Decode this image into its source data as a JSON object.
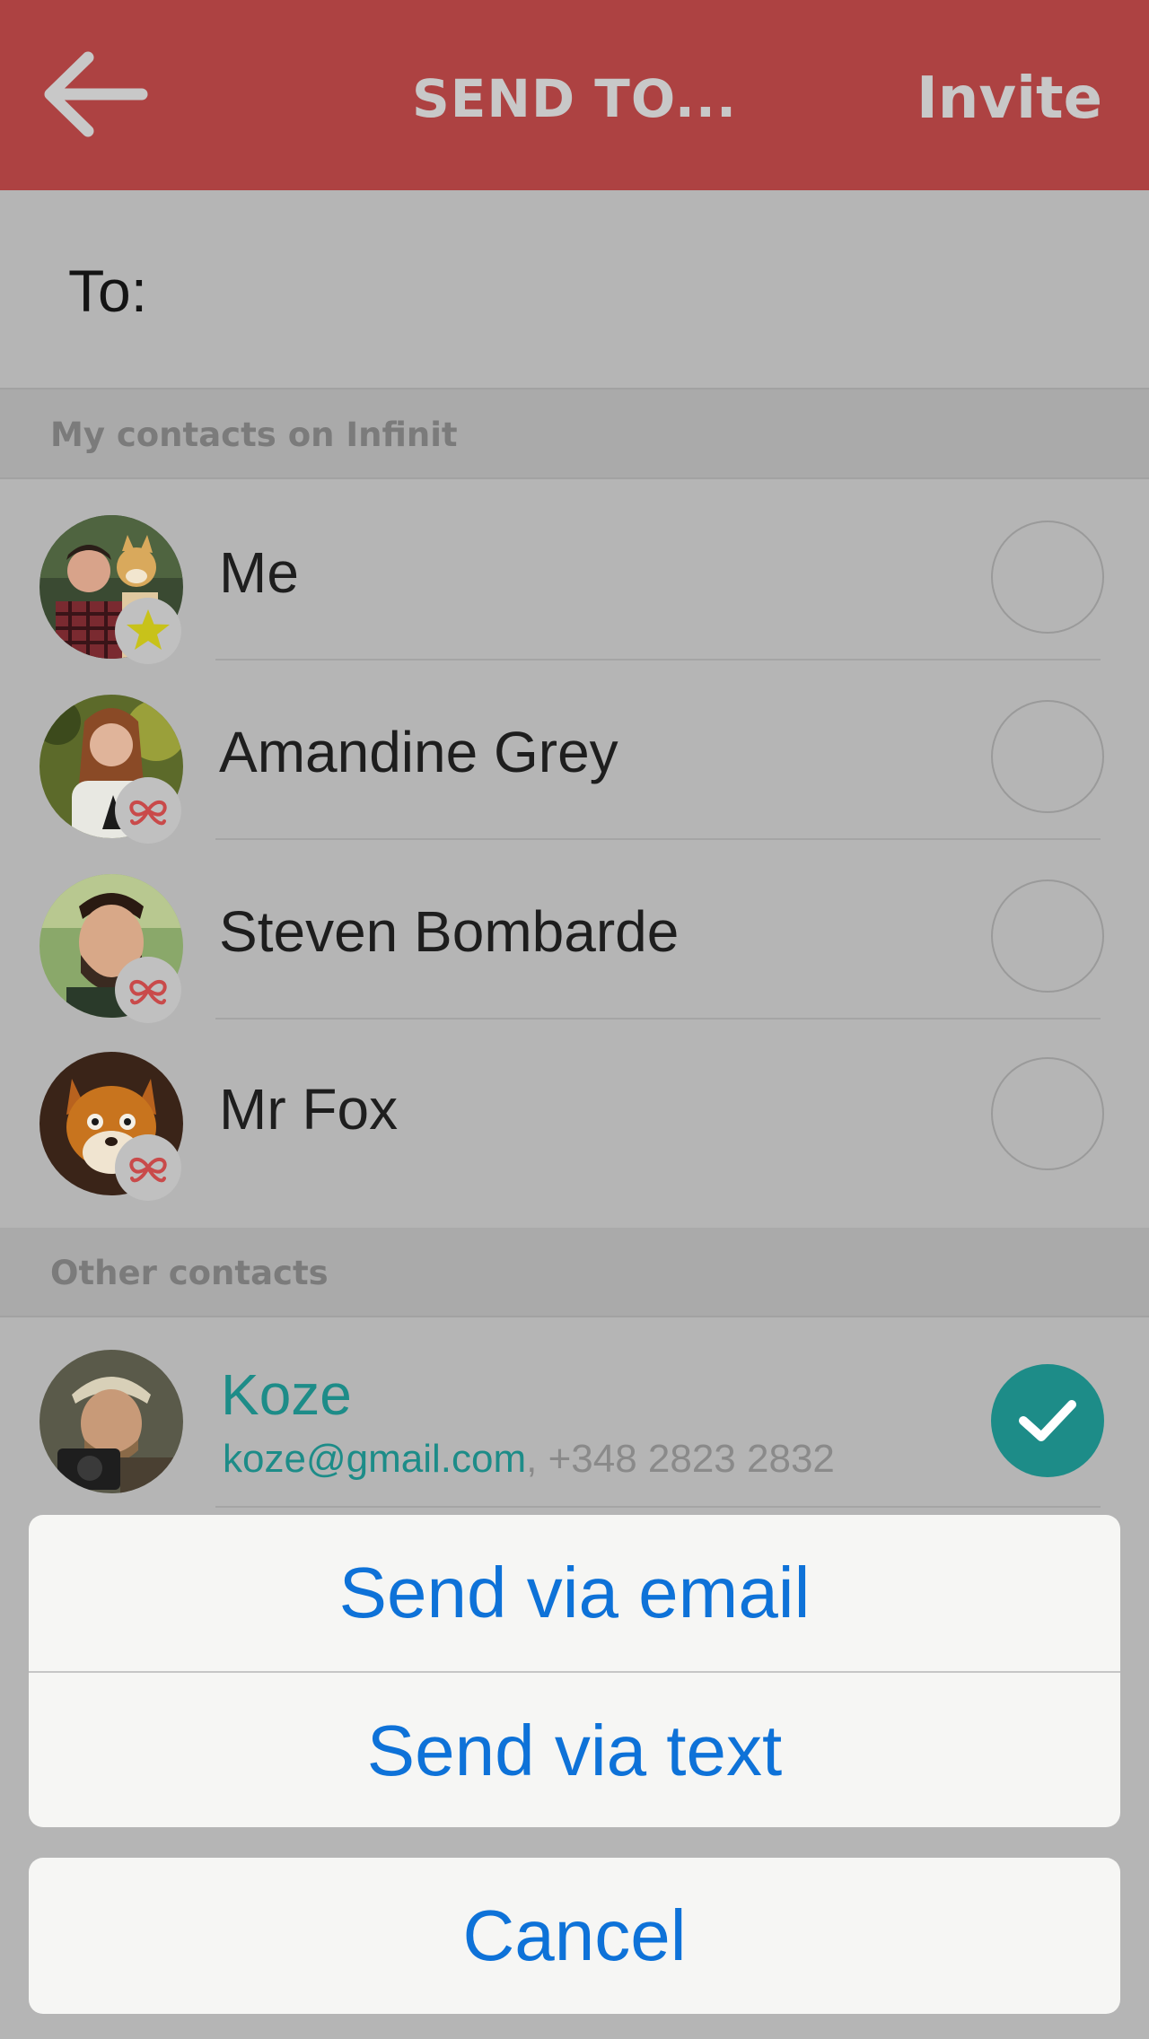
{
  "header": {
    "title": "SEND TO...",
    "invite_label": "Invite",
    "background": "#ad4242"
  },
  "to_field": {
    "label": "To:",
    "value": ""
  },
  "sections": {
    "infinit": {
      "title": "My contacts on Infinit"
    },
    "other": {
      "title": "Other contacts"
    }
  },
  "infinit_contacts": [
    {
      "name": "Me",
      "badge": "star-icon",
      "selected": false
    },
    {
      "name": "Amandine Grey",
      "badge": "infinit-logo-icon",
      "selected": false
    },
    {
      "name": "Steven Bombarde",
      "badge": "infinit-logo-icon",
      "selected": false
    },
    {
      "name": "Mr Fox",
      "badge": "infinit-logo-icon",
      "selected": false
    }
  ],
  "other_contacts": [
    {
      "name": "Koze",
      "email": "koze@gmail.com",
      "separator": ", ",
      "phone": "+348 2823 2832",
      "selected": true
    }
  ],
  "action_sheet": {
    "email_label": "Send via email",
    "text_label": "Send via text",
    "cancel_label": "Cancel"
  },
  "colors": {
    "accent_teal": "#1d8c88",
    "ios_blue": "#0e72d8",
    "star": "#c8c21a",
    "infinit_logo": "#c94a4a"
  }
}
